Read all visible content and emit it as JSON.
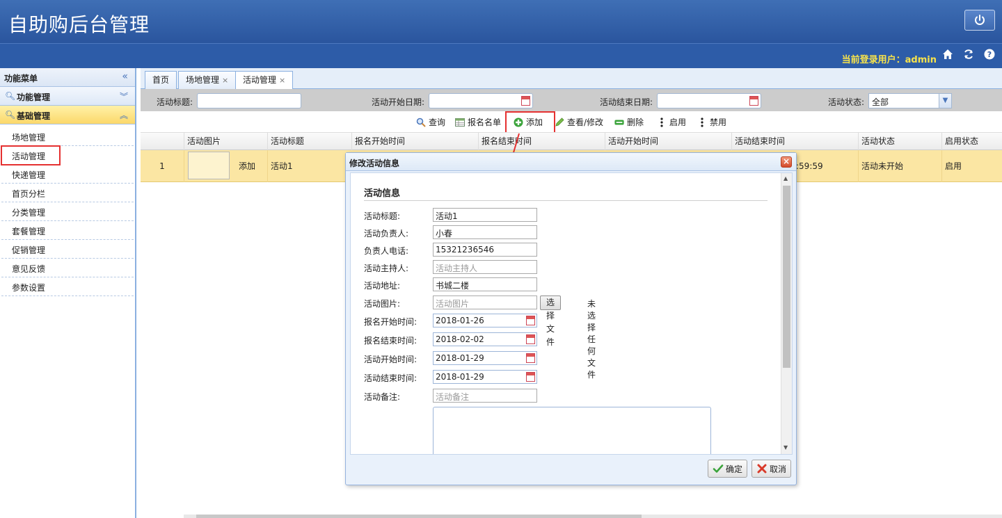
{
  "header": {
    "title": "自助购后台管理",
    "user_label": "当前登录用户：admin"
  },
  "sidebar": {
    "title": "功能菜单",
    "groups": [
      {
        "label": "功能管理"
      },
      {
        "label": "基础管理"
      }
    ],
    "items": [
      {
        "label": "场地管理"
      },
      {
        "label": "活动管理"
      },
      {
        "label": "快递管理"
      },
      {
        "label": "首页分栏"
      },
      {
        "label": "分类管理"
      },
      {
        "label": "套餐管理"
      },
      {
        "label": "促销管理"
      },
      {
        "label": "意见反馈"
      },
      {
        "label": "参数设置"
      }
    ]
  },
  "tabs": [
    {
      "label": "首页"
    },
    {
      "label": "场地管理"
    },
    {
      "label": "活动管理"
    }
  ],
  "filters": {
    "title_label": "活动标题:",
    "start_label": "活动开始日期:",
    "end_label": "活动结束日期:",
    "status_label": "活动状态:",
    "status_value": "全部"
  },
  "toolbar": {
    "query": "查询",
    "signup": "报名名单",
    "add": "添加",
    "edit": "查看/修改",
    "delete": "删除",
    "enable": "启用",
    "disable": "禁用"
  },
  "grid": {
    "columns": [
      "活动图片",
      "活动标题",
      "报名开始时间",
      "报名结束时间",
      "活动开始时间",
      "活动结束时间",
      "活动状态",
      "启用状态"
    ],
    "rows": [
      {
        "num": "1",
        "img_alt": "添加",
        "title": "活动1",
        "end_partial": ":59:59",
        "status": "活动未开始",
        "enabled": "启用"
      }
    ]
  },
  "dialog": {
    "title": "修改活动信息",
    "section": "活动信息",
    "fields": {
      "title": {
        "label": "活动标题:",
        "value": "活动1"
      },
      "leader": {
        "label": "活动负责人:",
        "value": "小春"
      },
      "phone": {
        "label": "负责人电话:",
        "value": "15321236546"
      },
      "host": {
        "label": "活动主持人:",
        "placeholder": "活动主持人"
      },
      "address": {
        "label": "活动地址:",
        "value": "书城二楼"
      },
      "image": {
        "label": "活动图片:",
        "placeholder": "活动图片",
        "button": "选择文件",
        "note": "未选择任何文件"
      },
      "signup_start": {
        "label": "报名开始时间:",
        "value": "2018-01-26"
      },
      "signup_end": {
        "label": "报名结束时间:",
        "value": "2018-02-02"
      },
      "start": {
        "label": "活动开始时间:",
        "value": "2018-01-29"
      },
      "end": {
        "label": "活动结束时间:",
        "value": "2018-01-29"
      },
      "remark": {
        "label": "活动备注:",
        "placeholder": "活动备注"
      }
    },
    "ok": "确定",
    "cancel": "取消"
  }
}
